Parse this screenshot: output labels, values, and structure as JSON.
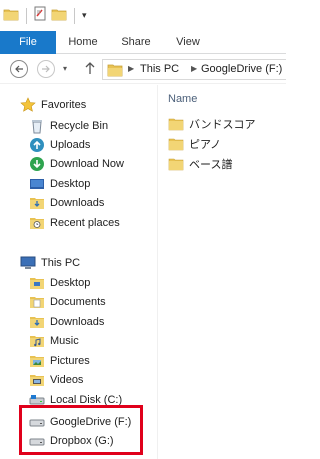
{
  "quick_access": {
    "icons": [
      "folder-icon",
      "properties-icon",
      "new-folder-icon",
      "customize-dropdown-icon"
    ],
    "dropdown_glyph": "▾"
  },
  "ribbon": {
    "tabs": [
      {
        "label": "File",
        "active": true
      },
      {
        "label": "Home"
      },
      {
        "label": "Share"
      },
      {
        "label": "View"
      }
    ]
  },
  "address_bar": {
    "breadcrumbs": [
      "This PC",
      "GoogleDrive (F:)"
    ],
    "separator": "▶",
    "recent_glyph": "▾"
  },
  "nav_pane": {
    "favorites": {
      "label": "Favorites",
      "items": [
        {
          "label": "Recycle Bin",
          "icon": "recycle-bin-icon"
        },
        {
          "label": "Uploads",
          "icon": "upload-icon"
        },
        {
          "label": "Download Now",
          "icon": "download-now-icon"
        },
        {
          "label": "Desktop",
          "icon": "desktop-icon"
        },
        {
          "label": "Downloads",
          "icon": "downloads-folder-icon"
        },
        {
          "label": "Recent places",
          "icon": "recent-places-icon"
        }
      ]
    },
    "this_pc": {
      "label": "This PC",
      "items": [
        {
          "label": "Desktop",
          "icon": "desktop-folder-icon"
        },
        {
          "label": "Documents",
          "icon": "documents-folder-icon"
        },
        {
          "label": "Downloads",
          "icon": "downloads-folder-icon"
        },
        {
          "label": "Music",
          "icon": "music-folder-icon"
        },
        {
          "label": "Pictures",
          "icon": "pictures-folder-icon"
        },
        {
          "label": "Videos",
          "icon": "videos-folder-icon"
        },
        {
          "label": "Local Disk (C:)",
          "icon": "local-disk-icon"
        },
        {
          "label": "GoogleDrive (F:)",
          "icon": "drive-icon"
        },
        {
          "label": "Dropbox (G:)",
          "icon": "drive-icon"
        }
      ]
    }
  },
  "content": {
    "column_header": "Name",
    "files": [
      {
        "name": "バンドスコア",
        "icon": "folder-icon"
      },
      {
        "name": "ピアノ",
        "icon": "folder-icon"
      },
      {
        "name": "ベース譜",
        "icon": "folder-icon"
      }
    ]
  },
  "colors": {
    "file_tab": "#1979ca",
    "highlight": "#e0001b",
    "folder": "#e8c253"
  }
}
